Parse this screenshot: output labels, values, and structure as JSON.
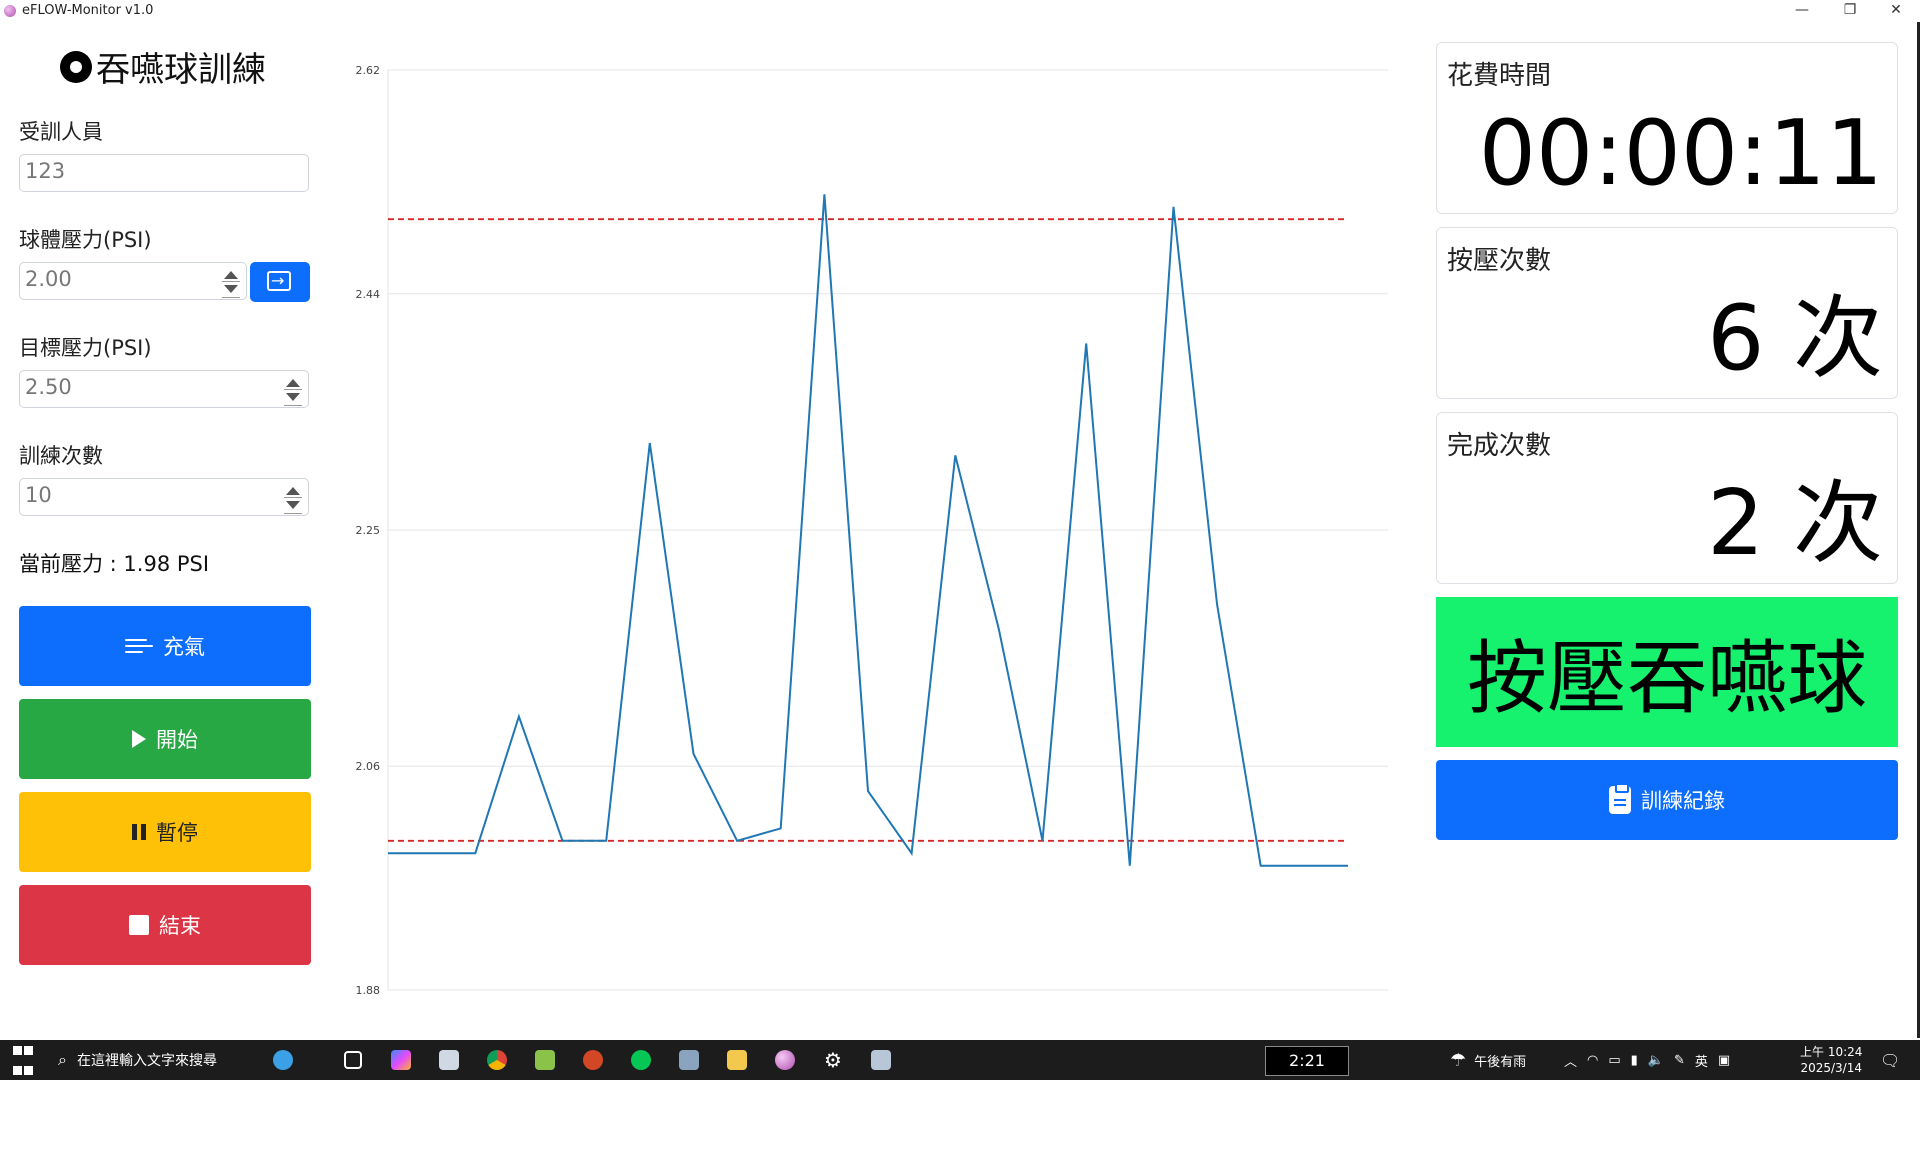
{
  "window": {
    "title": "eFLOW-Monitor v1.0"
  },
  "left_panel": {
    "heading": "吞嚥球訓練",
    "trainee_label": "受訓人員",
    "trainee_value": "123",
    "ball_pressure_label": "球體壓力(PSI)",
    "ball_pressure_value": "2.00",
    "target_pressure_label": "目標壓力(PSI)",
    "target_pressure_value": "2.50",
    "training_count_label": "訓練次數",
    "training_count_value": "10",
    "current_pressure": "當前壓力 : 1.98 PSI",
    "buttons": {
      "inflate": "充氣",
      "start": "開始",
      "pause": "暫停",
      "stop": "結束"
    }
  },
  "right_panel": {
    "elapsed_label": "花費時間",
    "elapsed_value": "00:00:11",
    "press_count_label": "按壓次數",
    "press_count_value": "6 次",
    "complete_count_label": "完成次數",
    "complete_count_value": "2 次",
    "banner_text": "按壓吞嚥球",
    "record_button": "訓練紀錄"
  },
  "chart_data": {
    "type": "line",
    "title": "",
    "xlabel": "",
    "ylabel": "",
    "ylim": [
      1.88,
      2.62
    ],
    "yticks": [
      "2.62",
      "2.44",
      "2.25",
      "2.06",
      "1.88"
    ],
    "grid": true,
    "series": [
      {
        "color": "#1f77b4",
        "values": [
          1.99,
          1.99,
          1.99,
          2.1,
          2.0,
          2.0,
          2.32,
          2.07,
          2.0,
          2.01,
          2.52,
          2.04,
          1.99,
          2.31,
          2.17,
          2.0,
          2.4,
          1.98,
          2.51,
          2.19,
          1.98,
          1.98,
          1.98
        ]
      }
    ],
    "threshold_lines": [
      {
        "value": 2.5,
        "color": "#d62728",
        "style": "dashed"
      },
      {
        "value": 2.0,
        "color": "#d62728",
        "style": "dashed"
      }
    ]
  },
  "taskbar": {
    "search_placeholder": "在這裡輸入文字來搜尋",
    "media_time": "2:21",
    "weather": "午後有雨",
    "ime": "英",
    "clock_time": "上午 10:24",
    "clock_date": "2025/3/14"
  }
}
